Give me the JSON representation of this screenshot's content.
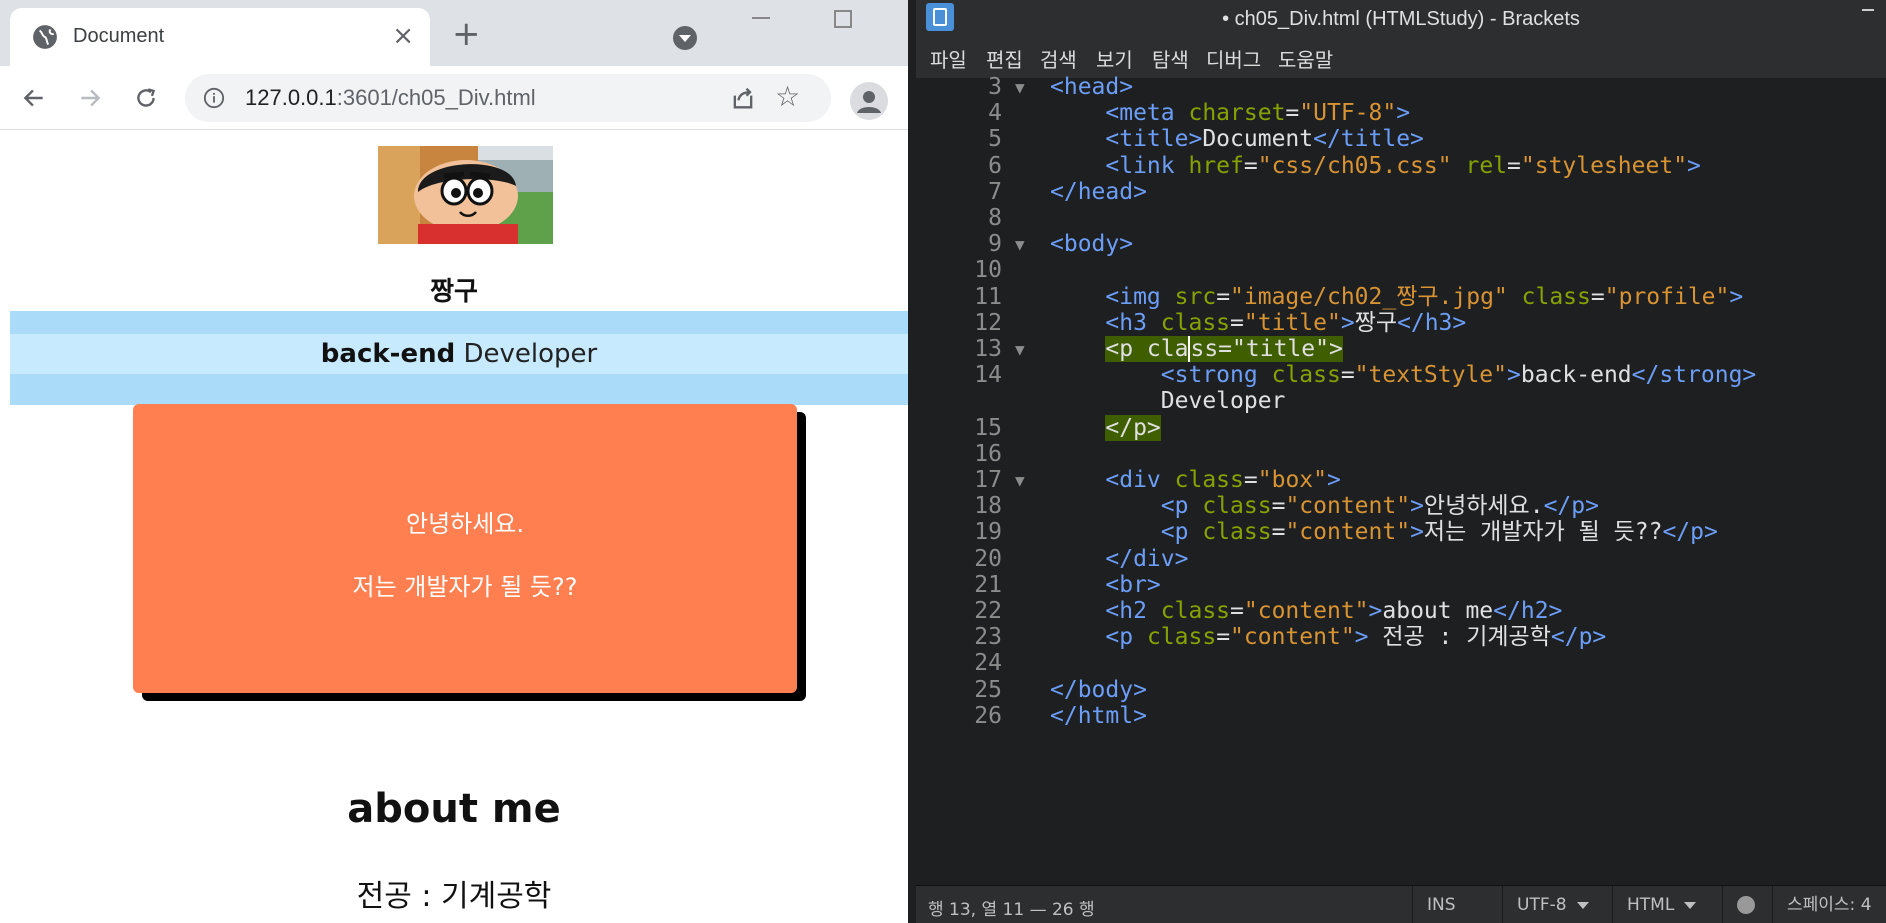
{
  "browser": {
    "tab_title": "Document",
    "tab_close": "×",
    "new_tab": "+",
    "url_host": "127.0.0.1",
    "url_rest": ":3601/ch05_Div.html",
    "icons": [
      "globe-icon",
      "back-arrow-icon",
      "forward-arrow-icon",
      "reload-icon",
      "info-icon",
      "share-icon",
      "star-icon",
      "profile-icon",
      "tab-search-icon"
    ]
  },
  "page": {
    "h3": "짱구",
    "strong_text": "back-end",
    "developer_text": " Developer",
    "box_line1": "안녕하세요.",
    "box_line2": "저는 개발자가 될 듯??",
    "h2": "about me",
    "major": "전공 : 기계공학",
    "colors": {
      "band": "#aadcfa",
      "band_inner": "#c8eafe",
      "box": "#ff7f50"
    }
  },
  "editor": {
    "title": "• ch05_Div.html (HTMLStudy) - Brackets",
    "menu": [
      "파일",
      "편집",
      "검색",
      "보기",
      "탐색",
      "디버그",
      "도움말"
    ],
    "status": {
      "cursor": "행 13, 열 11 — 26 행",
      "ins": "INS",
      "encoding": "UTF-8",
      "language": "HTML",
      "spaces": "스페이스: 4"
    },
    "lines": [
      {
        "n": "3",
        "fold": "▼",
        "parts": [
          [
            "tag",
            "<head>"
          ]
        ]
      },
      {
        "n": "4",
        "parts": [
          [
            "txt",
            "    "
          ],
          [
            "tag",
            "<meta "
          ],
          [
            "attr",
            "charset"
          ],
          [
            "txt",
            "="
          ],
          [
            "val",
            "\"UTF-8\""
          ],
          [
            "tag",
            ">"
          ]
        ]
      },
      {
        "n": "5",
        "parts": [
          [
            "txt",
            "    "
          ],
          [
            "tag",
            "<title>"
          ],
          [
            "txt",
            "Document"
          ],
          [
            "tag",
            "</title>"
          ]
        ]
      },
      {
        "n": "6",
        "parts": [
          [
            "txt",
            "    "
          ],
          [
            "tag",
            "<link "
          ],
          [
            "attr",
            "href"
          ],
          [
            "txt",
            "="
          ],
          [
            "val",
            "\"css/ch05.css\""
          ],
          [
            "txt",
            " "
          ],
          [
            "attr",
            "rel"
          ],
          [
            "txt",
            "="
          ],
          [
            "val",
            "\"stylesheet\""
          ],
          [
            "tag",
            ">"
          ]
        ]
      },
      {
        "n": "7",
        "parts": [
          [
            "tag",
            "</head>"
          ]
        ]
      },
      {
        "n": "8",
        "parts": []
      },
      {
        "n": "9",
        "fold": "▼",
        "parts": [
          [
            "tag",
            "<body>"
          ]
        ]
      },
      {
        "n": "10",
        "parts": []
      },
      {
        "n": "11",
        "parts": [
          [
            "txt",
            "    "
          ],
          [
            "tag",
            "<img "
          ],
          [
            "attr",
            "src"
          ],
          [
            "txt",
            "="
          ],
          [
            "val",
            "\"image/ch02_짱구.jpg\""
          ],
          [
            "txt",
            " "
          ],
          [
            "attr",
            "class"
          ],
          [
            "txt",
            "="
          ],
          [
            "val",
            "\"profile\""
          ],
          [
            "tag",
            ">"
          ]
        ]
      },
      {
        "n": "12",
        "parts": [
          [
            "txt",
            "    "
          ],
          [
            "tag",
            "<h3 "
          ],
          [
            "attr",
            "class"
          ],
          [
            "txt",
            "="
          ],
          [
            "val",
            "\"title\""
          ],
          [
            "tag",
            ">"
          ],
          [
            "txt",
            "짱구"
          ],
          [
            "tag",
            "</h3>"
          ]
        ]
      },
      {
        "n": "13",
        "fold": "▼",
        "parts": [
          [
            "txt",
            "    "
          ],
          [
            "hl",
            "<p cla"
          ],
          [
            "hlc",
            "ss=\"title\">"
          ]
        ]
      },
      {
        "n": "14",
        "parts": [
          [
            "txt",
            "        "
          ],
          [
            "tag",
            "<strong "
          ],
          [
            "attr",
            "class"
          ],
          [
            "txt",
            "="
          ],
          [
            "val",
            "\"textStyle\""
          ],
          [
            "tag",
            ">"
          ],
          [
            "txt",
            "back-end"
          ],
          [
            "tag",
            "</strong>"
          ]
        ]
      },
      {
        "n": "",
        "parts": [
          [
            "txt",
            "        Developer"
          ]
        ]
      },
      {
        "n": "15",
        "parts": [
          [
            "txt",
            "    "
          ],
          [
            "hl",
            "</p>"
          ]
        ]
      },
      {
        "n": "16",
        "parts": []
      },
      {
        "n": "17",
        "fold": "▼",
        "parts": [
          [
            "txt",
            "    "
          ],
          [
            "tag",
            "<div "
          ],
          [
            "attr",
            "class"
          ],
          [
            "txt",
            "="
          ],
          [
            "val",
            "\"box\""
          ],
          [
            "tag",
            ">"
          ]
        ]
      },
      {
        "n": "18",
        "parts": [
          [
            "txt",
            "        "
          ],
          [
            "tag",
            "<p "
          ],
          [
            "attr",
            "class"
          ],
          [
            "txt",
            "="
          ],
          [
            "val",
            "\"content\""
          ],
          [
            "tag",
            ">"
          ],
          [
            "txt",
            "안녕하세요."
          ],
          [
            "tag",
            "</p>"
          ]
        ]
      },
      {
        "n": "19",
        "parts": [
          [
            "txt",
            "        "
          ],
          [
            "tag",
            "<p "
          ],
          [
            "attr",
            "class"
          ],
          [
            "txt",
            "="
          ],
          [
            "val",
            "\"content\""
          ],
          [
            "tag",
            ">"
          ],
          [
            "txt",
            "저는 개발자가 될 듯??"
          ],
          [
            "tag",
            "</p>"
          ]
        ]
      },
      {
        "n": "20",
        "parts": [
          [
            "txt",
            "    "
          ],
          [
            "tag",
            "</div>"
          ]
        ]
      },
      {
        "n": "21",
        "parts": [
          [
            "txt",
            "    "
          ],
          [
            "tag",
            "<br>"
          ]
        ]
      },
      {
        "n": "22",
        "parts": [
          [
            "txt",
            "    "
          ],
          [
            "tag",
            "<h2 "
          ],
          [
            "attr",
            "class"
          ],
          [
            "txt",
            "="
          ],
          [
            "val",
            "\"content\""
          ],
          [
            "tag",
            ">"
          ],
          [
            "txt",
            "about me"
          ],
          [
            "tag",
            "</h2>"
          ]
        ]
      },
      {
        "n": "23",
        "parts": [
          [
            "txt",
            "    "
          ],
          [
            "tag",
            "<p "
          ],
          [
            "attr",
            "class"
          ],
          [
            "txt",
            "="
          ],
          [
            "val",
            "\"content\""
          ],
          [
            "tag",
            ">"
          ],
          [
            "txt",
            " 전공 : 기계공학"
          ],
          [
            "tag",
            "</p>"
          ]
        ]
      },
      {
        "n": "24",
        "parts": []
      },
      {
        "n": "25",
        "parts": [
          [
            "tag",
            "</body>"
          ]
        ]
      },
      {
        "n": "26",
        "parts": [
          [
            "tag",
            "</html>"
          ]
        ]
      }
    ]
  }
}
